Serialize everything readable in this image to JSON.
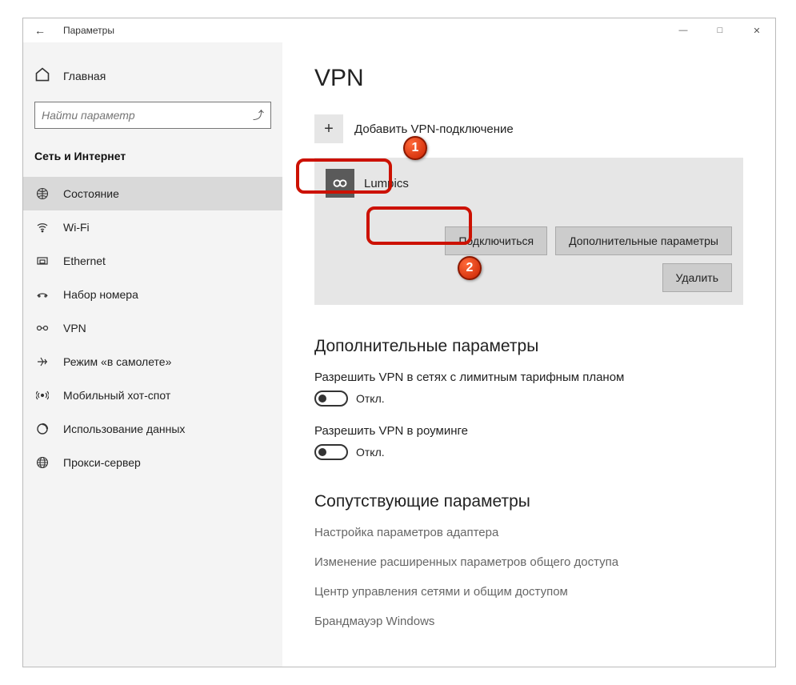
{
  "titlebar": {
    "title": "Параметры"
  },
  "sidebar": {
    "home": "Главная",
    "search_placeholder": "Найти параметр",
    "group": "Сеть и Интернет",
    "items": [
      {
        "label": "Состояние",
        "icon": "globe-grid-icon",
        "active": true
      },
      {
        "label": "Wi-Fi",
        "icon": "wifi-icon",
        "active": false
      },
      {
        "label": "Ethernet",
        "icon": "ethernet-icon",
        "active": false
      },
      {
        "label": "Набор номера",
        "icon": "dialup-icon",
        "active": false
      },
      {
        "label": "VPN",
        "icon": "vpn-icon",
        "active": false
      },
      {
        "label": "Режим «в самолете»",
        "icon": "airplane-icon",
        "active": false
      },
      {
        "label": "Мобильный хот-спот",
        "icon": "hotspot-icon",
        "active": false
      },
      {
        "label": "Использование данных",
        "icon": "data-usage-icon",
        "active": false
      },
      {
        "label": "Прокси-сервер",
        "icon": "proxy-icon",
        "active": false
      }
    ]
  },
  "main": {
    "title": "VPN",
    "add_label": "Добавить VPN-подключение",
    "entry": {
      "name": "Lumpics"
    },
    "btn_connect": "Подключиться",
    "btn_advanced": "Дополнительные параметры",
    "btn_delete": "Удалить",
    "extra_heading": "Дополнительные параметры",
    "opt1_label": "Разрешить VPN в сетях с лимитным тарифным планом",
    "opt2_label": "Разрешить VPN в роуминге",
    "toggle_off": "Откл.",
    "related_heading": "Сопутствующие параметры",
    "links": [
      "Настройка параметров адаптера",
      "Изменение расширенных параметров общего доступа",
      "Центр управления сетями и общим доступом",
      "Брандмауэр Windows"
    ]
  },
  "steps": {
    "s1": "1",
    "s2": "2"
  }
}
